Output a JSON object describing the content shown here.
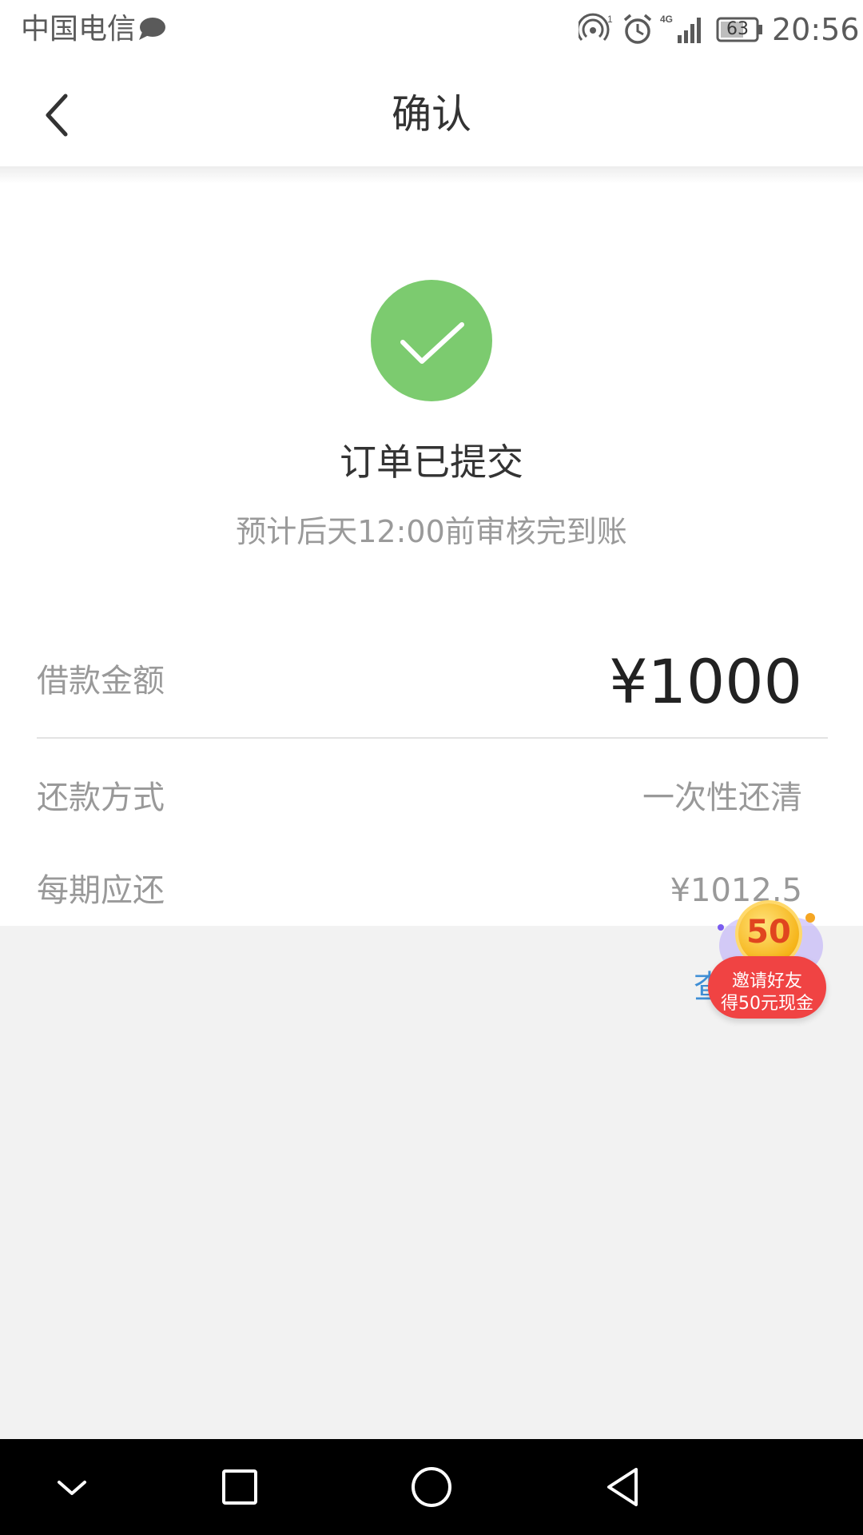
{
  "status_bar": {
    "carrier": "中国电信",
    "battery": "63",
    "time": "20:56",
    "icons": [
      "message-icon",
      "hotspot-icon",
      "alarm-icon",
      "signal-4g-icon",
      "battery-icon"
    ]
  },
  "header": {
    "title": "确认",
    "back_icon": "chevron-left-icon"
  },
  "result": {
    "icon": "check-circle-icon",
    "icon_color": "#7ccb6f",
    "title": "订单已提交",
    "subtitle": "预计后天12:00前审核完到账"
  },
  "details": {
    "loan_amount_label": "借款金额",
    "loan_amount_value": "¥1000",
    "repay_method_label": "还款方式",
    "repay_method_value": "一次性还清",
    "per_period_label": "每期应还",
    "per_period_value": "¥1012.5"
  },
  "hidden_link": {
    "text": "查"
  },
  "promo": {
    "coin_value": "50",
    "line1": "邀请好友",
    "line2": "得50元现金",
    "color": "#f04343"
  },
  "android_nav": {
    "buttons": [
      "hide-keyboard-icon",
      "recents-icon",
      "home-icon",
      "back-triangle-icon"
    ]
  }
}
